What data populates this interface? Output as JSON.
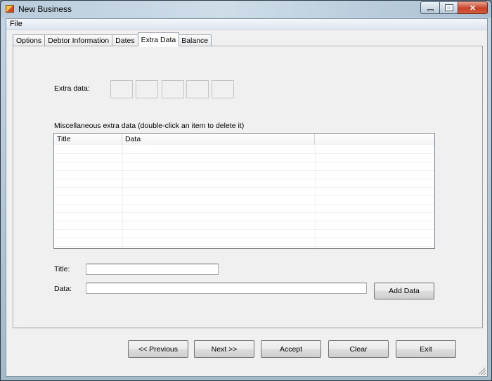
{
  "window": {
    "title": "New Business",
    "icon": "app-icon",
    "controls": [
      "minimize-icon",
      "maximize-icon",
      "close-icon"
    ],
    "close_glyph": "✕"
  },
  "menubar": {
    "items": [
      "File"
    ]
  },
  "tabs": [
    {
      "label": "Options",
      "active": false
    },
    {
      "label": "Debtor Information",
      "active": false
    },
    {
      "label": "Dates",
      "active": false
    },
    {
      "label": "Extra Data",
      "active": true
    },
    {
      "label": "Balance",
      "active": false
    }
  ],
  "extra_data": {
    "label": "Extra data:",
    "boxes": [
      "",
      "",
      "",
      "",
      ""
    ]
  },
  "misc": {
    "label": "Miscellaneous extra data (double-click an item to delete it)",
    "columns": [
      "Title",
      "Data",
      ""
    ],
    "rows": []
  },
  "form": {
    "title_label": "Title:",
    "title_value": "",
    "data_label": "Data:",
    "data_value": "",
    "add_button": "Add Data"
  },
  "footer": {
    "previous": "<< Previous",
    "next": "Next >>",
    "accept": "Accept",
    "clear": "Clear",
    "exit": "Exit"
  }
}
